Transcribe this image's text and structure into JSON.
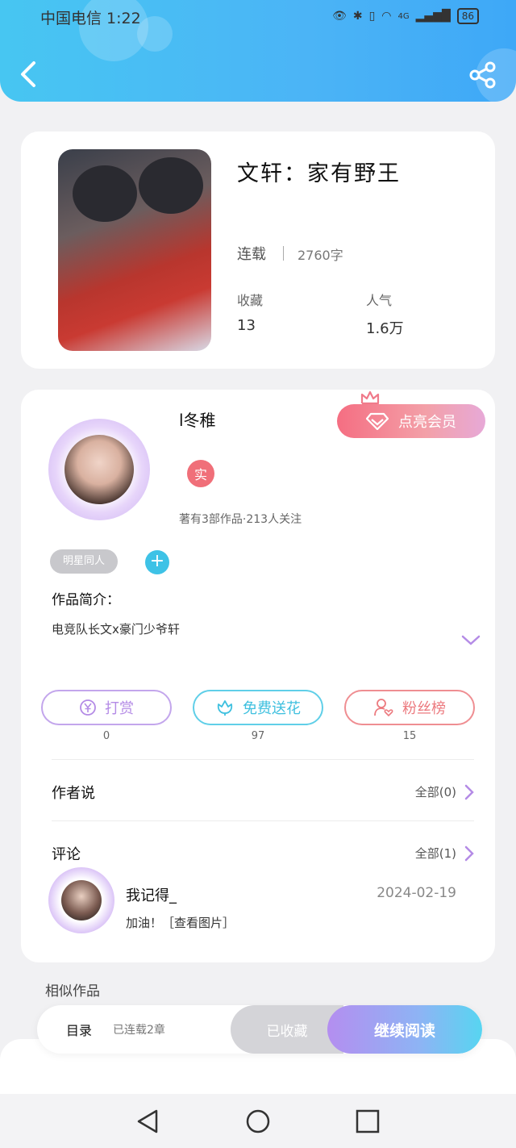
{
  "status_bar": {
    "carrier_time": "中国电信 1:22",
    "network": "4G",
    "battery": "86"
  },
  "book": {
    "title": "文轩：家有野王",
    "status": "连载",
    "words": "2760字",
    "favorites_label": "收藏",
    "favorites_value": "13",
    "popularity_label": "人气",
    "popularity_value": "1.6万"
  },
  "author": {
    "name": "l冬稚",
    "verified_badge": "实",
    "stats": "著有3部作品·213人关注",
    "vip_button": "点亮会员",
    "tag": "明星同人",
    "add_tag": "+",
    "intro_title": "作品简介：",
    "intro_text": "电竞队长文x豪门少爷轩"
  },
  "actions": [
    {
      "label": "打赏",
      "count": "0",
      "color": "#b48be6",
      "icon": "yen-icon"
    },
    {
      "label": "免费送花",
      "count": "97",
      "color": "#46c6e3",
      "icon": "flower-icon"
    },
    {
      "label": "粉丝榜",
      "count": "15",
      "color": "#ec7a7f",
      "icon": "fan-icon"
    }
  ],
  "author_says": {
    "title": "作者说",
    "more": "全部(0)"
  },
  "comments": {
    "title": "评论",
    "more": "全部(1)",
    "items": [
      {
        "user": "我记得_",
        "date": "2024-02-19",
        "text": "加油！［查看图片］"
      }
    ]
  },
  "similar_title": "相似作品",
  "reader_bar": {
    "toc": "目录",
    "chapters": "已连载2章",
    "collected": "已收藏",
    "continue": "继续阅读"
  },
  "colors": {
    "header": "#47c6f2",
    "accent_purple": "#b48ef0",
    "accent_cyan": "#57d5f1",
    "vip_pink": "#f56e82"
  }
}
